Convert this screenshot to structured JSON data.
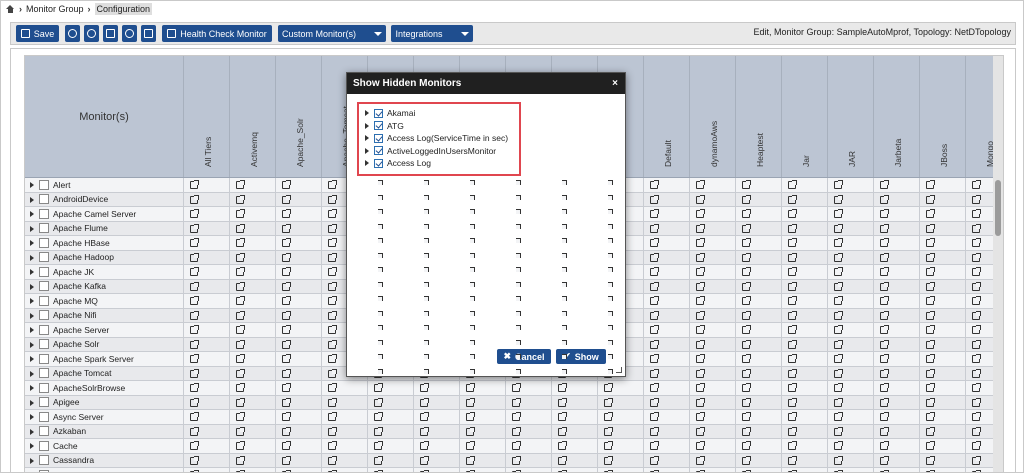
{
  "breadcrumb": {
    "home_icon": "home-icon",
    "item1": "Monitor Group",
    "item2": "Configuration"
  },
  "toolbar": {
    "save_label": "Save",
    "health_check_label": "Health Check Monitor",
    "custom_monitors_label": "Custom Monitor(s)",
    "integrations_label": "Integrations",
    "info_text": "Edit, Monitor Group: SampleAutoMprof,  Topology: NetDTopology"
  },
  "grid": {
    "name_header": "Monitor(s)",
    "columns": [
      "All Tiers",
      "Activemq",
      "Apache_Solr",
      "Apache_Tomcat",
      "",
      "",
      "",
      "",
      "",
      "",
      "Default",
      "dynamoAws",
      "Heaptest",
      "Jar",
      "JAR",
      "Jarbeta",
      "JBoss",
      "Mongo"
    ],
    "rows": [
      "Alert",
      "AndroidDevice",
      "Apache Camel Server",
      "Apache Flume",
      "Apache HBase",
      "Apache Hadoop",
      "Apache JK",
      "Apache Kafka",
      "Apache MQ",
      "Apache Nifi",
      "Apache Server",
      "Apache Solr",
      "Apache Spark Server",
      "Apache Tomcat",
      "ApacheSolrBrowse",
      "Apigee",
      "Async Server",
      "Azkaban",
      "Cache",
      "Cassandra",
      "Couchase"
    ]
  },
  "modal": {
    "title": "Show Hidden Monitors",
    "close": "×",
    "items": [
      "Akamai",
      "ATG",
      "Access Log(ServiceTime in sec)",
      "ActiveLoggedInUsersMonitor",
      "Access Log"
    ],
    "cancel_label": "Cancel",
    "show_label": "Show"
  },
  "colors": {
    "primary": "#1f4e8f",
    "highlight": "#e0464f",
    "header": "#bcc5d3",
    "modal_title": "#202020"
  }
}
